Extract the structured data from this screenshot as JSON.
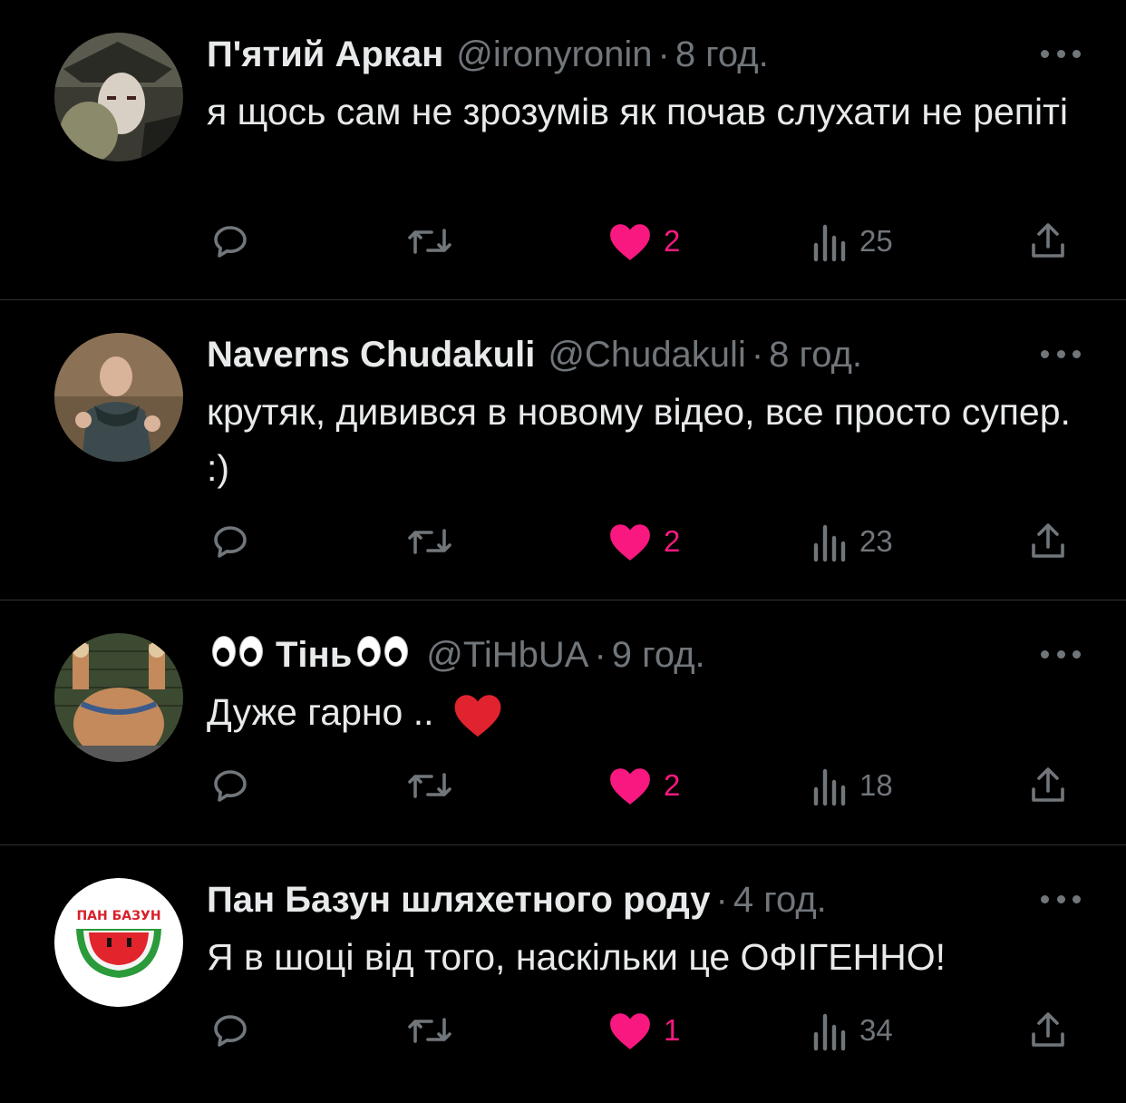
{
  "tweets": [
    {
      "name": "П'ятий Аркан",
      "handle": "@ironyronin",
      "time": "8 год.",
      "text": "я щось сам не зрозумів як почав слухати не репіті",
      "likes": "2",
      "views": "25"
    },
    {
      "name": "Naverns Chudakuli",
      "handle": "@Chudakuli",
      "time": "8 год.",
      "text": "крутяк, дивився в новому відео, все просто супер. :)",
      "likes": "2",
      "views": "23"
    },
    {
      "name": "Тінь",
      "handle": "@TiHbUA",
      "time": "9 год.",
      "text": "Дуже гарно ..",
      "likes": "2",
      "views": "18"
    },
    {
      "name": "Пан Базун шляхетного роду",
      "time": "4 год.",
      "text": "Я в шоці від того, наскільки це ОФІГЕННО!",
      "avatar_text": "ПАН БАЗУН",
      "likes": "1",
      "views": "34"
    }
  ],
  "colors": {
    "background": "#000000",
    "text": "#e7e9ea",
    "muted": "#71767b",
    "like": "#f91880",
    "divider": "#2f3336"
  },
  "icons": [
    "reply-icon",
    "retweet-icon",
    "heart-icon",
    "views-icon",
    "share-icon",
    "more-icon"
  ]
}
